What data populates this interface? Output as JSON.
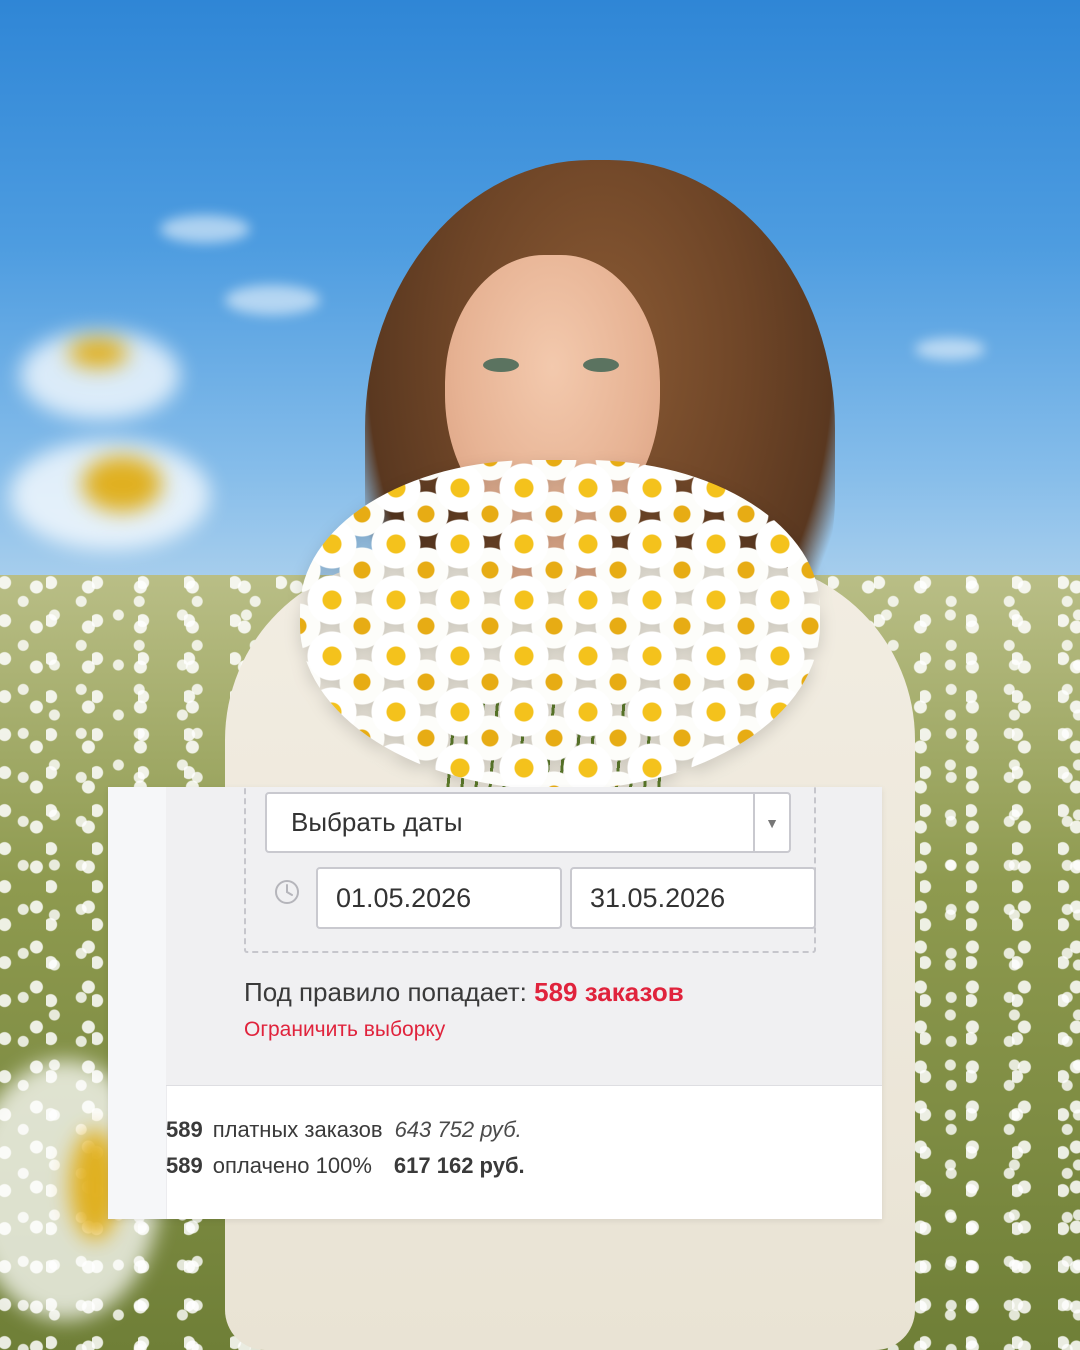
{
  "date_filter": {
    "preset_select": {
      "selected": "Выбрать даты"
    },
    "from": "01.05.2026",
    "to": "31.05.2026"
  },
  "rule_summary": {
    "prefix": "Под правило попадает: ",
    "highlight": "589 заказов",
    "limit_link": "Ограничить выборку"
  },
  "stats": {
    "paid": {
      "count": "589",
      "label": "платных заказов",
      "amount": "643 752 руб."
    },
    "settled": {
      "count": "589",
      "label": "оплачено 100%",
      "amount": "617 162 руб."
    }
  },
  "colors": {
    "accent": "#e0233c",
    "panel_bg": "#f0f0f2",
    "sky": "#4d9ce0"
  },
  "icons": {
    "select_arrow": "chevron-down-icon",
    "time": "clock-icon"
  }
}
